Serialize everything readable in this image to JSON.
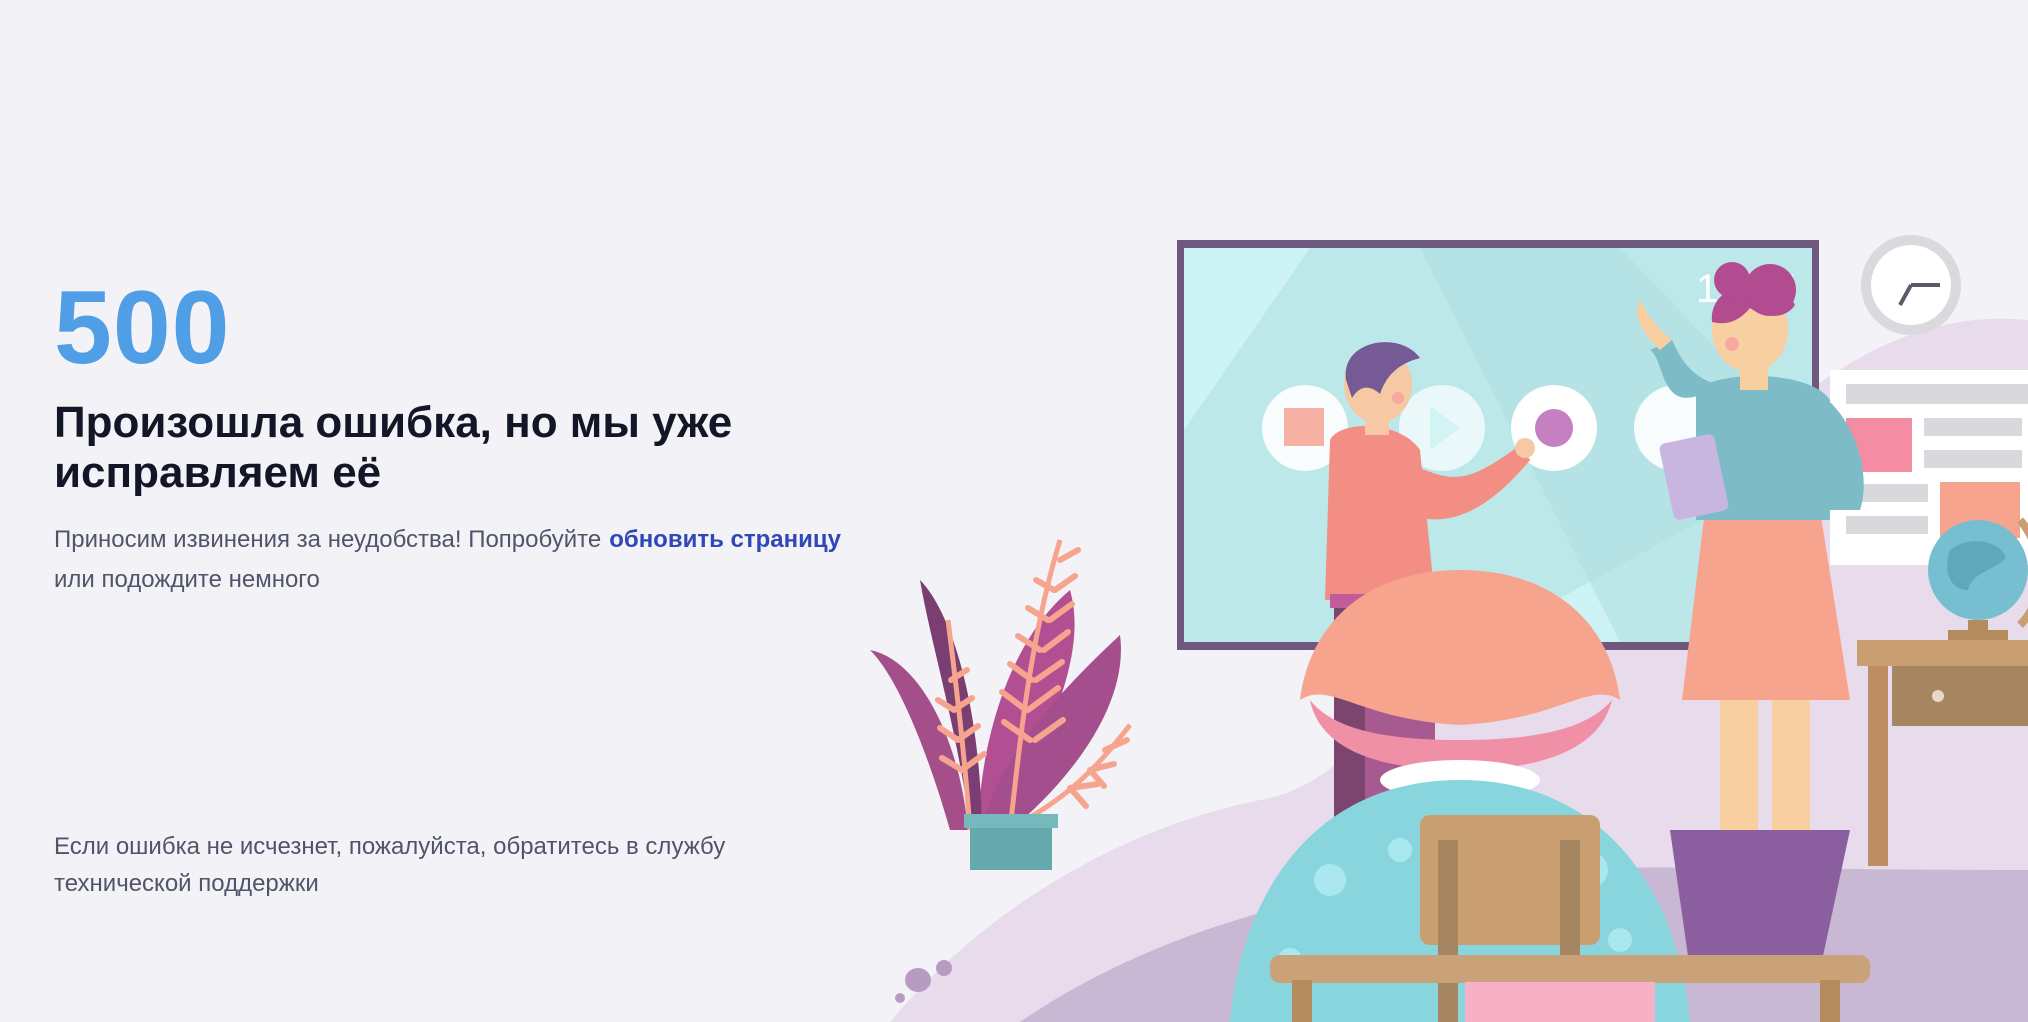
{
  "error": {
    "code": "500",
    "title": "Произошла ошибка, но мы уже исправляем её",
    "message_prefix": "Приносим извинения за неудобства! Попробуйте",
    "refresh_link": "обновить страницу",
    "message_suffix": "или подождите немного",
    "support_text": "Если ошибка не исчезнет, пожалуйста, обратитесь в службу технической поддержки"
  },
  "illustration": {
    "screen_time": "12:15",
    "icons": [
      "classroom-illustration",
      "clock-icon",
      "globe-icon",
      "plant-icon"
    ]
  },
  "colors": {
    "background": "#f3f3f7",
    "code": "#4f9ee6",
    "title": "#121626",
    "text": "#50546a",
    "link": "#3047b8"
  }
}
